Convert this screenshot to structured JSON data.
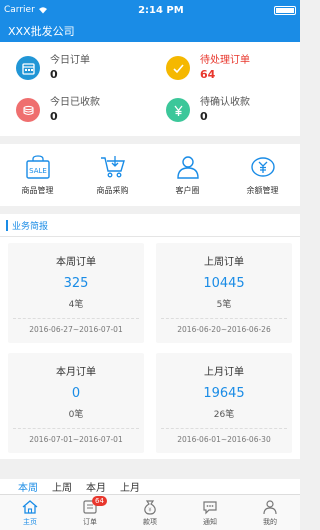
{
  "status_bar": {
    "carrier": "Carrier",
    "time": "2:14 PM"
  },
  "header": {
    "title": "XXX批发公司"
  },
  "stats": [
    {
      "label": "今日订单",
      "value": "0",
      "icon": "calendar-icon",
      "color": "#2196d6",
      "highlight": false
    },
    {
      "label": "待处理订单",
      "value": "64",
      "icon": "check-icon",
      "color": "#f5b800",
      "highlight": true
    },
    {
      "label": "今日已收款",
      "value": "0",
      "icon": "coins-icon",
      "color": "#ef6f6f",
      "highlight": false
    },
    {
      "label": "待确认收款",
      "value": "0",
      "icon": "yen-icon",
      "color": "#3cc79a",
      "highlight": false
    }
  ],
  "actions": [
    {
      "label": "商品管理",
      "icon": "sale-bag-icon"
    },
    {
      "label": "商品采购",
      "icon": "cart-icon"
    },
    {
      "label": "客户圈",
      "icon": "person-icon"
    },
    {
      "label": "余额管理",
      "icon": "wallet-yen-icon"
    }
  ],
  "business": {
    "title": "业务简报",
    "cards": [
      {
        "title": "本周订单",
        "value": "325",
        "count": "4笔",
        "dates": "2016-06-27~2016-07-01"
      },
      {
        "title": "上周订单",
        "value": "10445",
        "count": "5笔",
        "dates": "2016-06-20~2016-06-26"
      },
      {
        "title": "本月订单",
        "value": "0",
        "count": "0笔",
        "dates": "2016-07-01~2016-07-01"
      },
      {
        "title": "上月订单",
        "value": "19645",
        "count": "26笔",
        "dates": "2016-06-01~2016-06-30"
      }
    ]
  },
  "period_tabs": [
    "本周",
    "上周",
    "本月",
    "上月"
  ],
  "tab_bar": {
    "items": [
      {
        "label": "主页",
        "icon": "home-icon",
        "active": true
      },
      {
        "label": "订单",
        "icon": "order-icon",
        "badge": "64"
      },
      {
        "label": "款项",
        "icon": "money-bag-icon"
      },
      {
        "label": "通知",
        "icon": "chat-icon"
      },
      {
        "label": "我的",
        "icon": "user-icon"
      }
    ]
  },
  "colors": {
    "primary": "#1a8ce6",
    "alert": "#e8372d"
  }
}
